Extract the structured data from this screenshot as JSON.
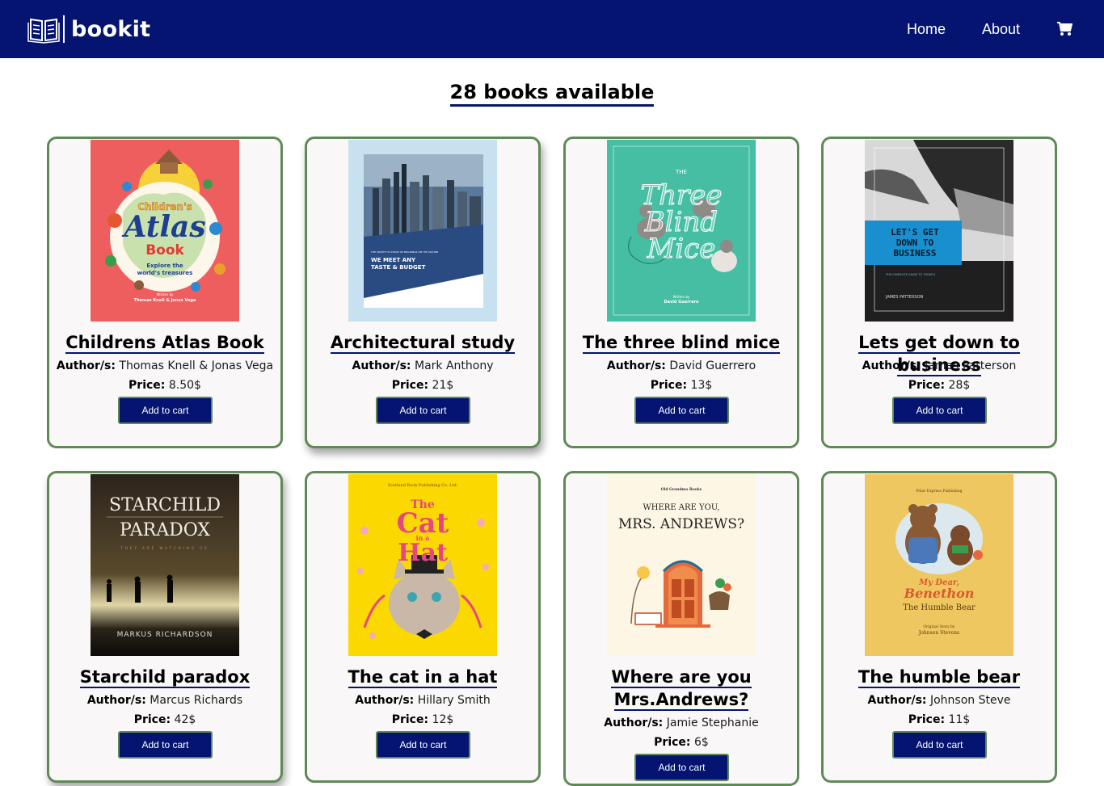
{
  "navbar": {
    "brand": "bookit",
    "links": {
      "home": "Home",
      "about": "About"
    },
    "cart_icon": "shopping-cart-icon",
    "background": "#041470"
  },
  "heading": "28 books available",
  "colors": {
    "accent": "#041470",
    "card_border": "#5f8a57",
    "card_bg": "#f9f7f8"
  },
  "labels": {
    "author": "Author/s:",
    "price": "Price:",
    "add_to_cart": "Add to cart"
  },
  "books": [
    {
      "title": "Childrens Atlas Book",
      "authors": "Thomas Knell & Jonas Vega",
      "price": "8.50$",
      "cover": {
        "line1": "Children's",
        "line2": "Atlas",
        "line3": "Book",
        "line4": "Explore the",
        "line5": "world's treasures",
        "line6": "Written by",
        "line7": "Thomas Knell & Jonas Vega"
      }
    },
    {
      "title": "Architectural study",
      "authors": "Mark Anthony",
      "price": "21$",
      "cover": {
        "line1": "THE SOCIETY'S CHOICE OF BUILDINGS ON THE SKYLINE",
        "line2": "WE MEET ANY",
        "line3": "TASTE & BUDGET"
      }
    },
    {
      "title": "The three blind mice",
      "authors": "David Guerrero",
      "price": "13$",
      "cover": {
        "line1": "THE",
        "line2": "Three",
        "line3": "Blind",
        "line4": "Mice",
        "line5": "Written by",
        "line6": "David Guerrero"
      }
    },
    {
      "title": "Lets get down to business",
      "authors": "James Patterson",
      "price": "28$",
      "cover": {
        "line1": "LET'S GET",
        "line2": "DOWN TO",
        "line3": "BUSINESS",
        "line4": "THE COMPLETE GUIDE TO TODAY'S",
        "line5": "JAMES PATTERSON"
      }
    },
    {
      "title": "Starchild paradox",
      "authors": "Marcus Richards",
      "price": "42$",
      "cover": {
        "line1": "STARCHILD",
        "line2": "PARADOX",
        "line3": "THEY ARE WATCHING US",
        "line4": "MARKUS RICHARDSON"
      }
    },
    {
      "title": "The cat in a hat",
      "authors": "Hillary Smith",
      "price": "12$",
      "cover": {
        "line1": "Scotland Book Publishing Co. Ltd.",
        "line2": "The",
        "line3": "Cat",
        "line4": "in a",
        "line5": "Hat"
      }
    },
    {
      "title": "Where are you Mrs.Andrews?",
      "authors": "Jamie Stephanie",
      "price": "6$",
      "cover": {
        "line1": "Old Grandma Books",
        "line2": "WHERE ARE YOU,",
        "line3": "MRS. ANDREWS?"
      }
    },
    {
      "title": "The humble bear",
      "authors": "Johnson Steve",
      "price": "11$",
      "cover": {
        "line1": "Polar Express Publishing",
        "line2": "My Dear,",
        "line3": "Benethon",
        "line4": "The Humble Bear",
        "line5": "Original Story by",
        "line6": "Johnson Stevens"
      }
    }
  ]
}
